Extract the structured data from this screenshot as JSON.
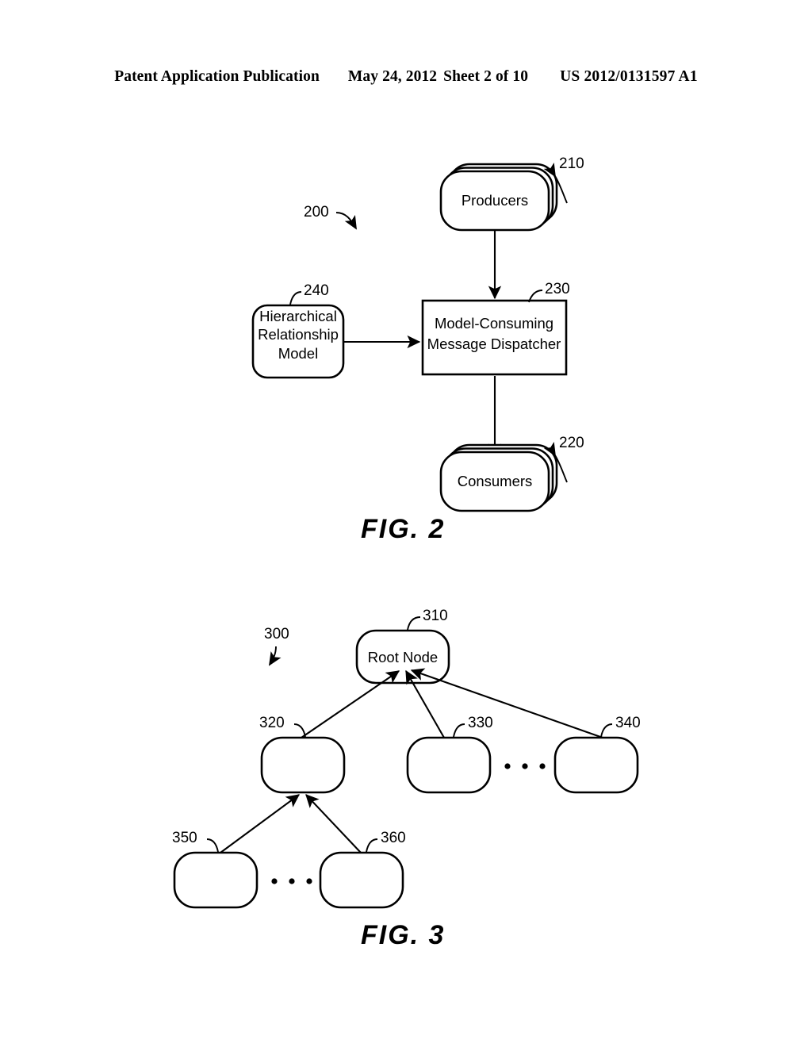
{
  "header": {
    "publication": "Patent Application Publication",
    "date": "May 24, 2012",
    "sheet": "Sheet 2 of 10",
    "document_number": "US 2012/0131597 A1"
  },
  "figures": [
    {
      "id": "fig2",
      "caption": "FIG.  2",
      "system_ref": "200",
      "nodes": [
        {
          "ref": "210",
          "label": "Producers",
          "shape": "stacked-rounded-rect"
        },
        {
          "ref": "230",
          "label_line1": "Model-Consuming",
          "label_line2": "Message Dispatcher",
          "shape": "rect"
        },
        {
          "ref": "240",
          "label_line1": "Hierarchical",
          "label_line2": "Relationship",
          "label_line3": "Model",
          "shape": "rounded-rect"
        },
        {
          "ref": "220",
          "label": "Consumers",
          "shape": "stacked-rounded-rect"
        }
      ],
      "connections": [
        {
          "from": "210",
          "to": "230",
          "style": "arrow"
        },
        {
          "from": "240",
          "to": "230",
          "style": "arrow"
        },
        {
          "from": "230",
          "to": "220",
          "style": "arrow"
        }
      ]
    },
    {
      "id": "fig3",
      "caption": "FIG.  3",
      "system_ref": "300",
      "nodes": [
        {
          "ref": "310",
          "label": "Root Node",
          "shape": "rounded-rect"
        },
        {
          "ref": "320",
          "label": "",
          "shape": "rounded-rect"
        },
        {
          "ref": "330",
          "label": "",
          "shape": "rounded-rect"
        },
        {
          "ref": "340",
          "label": "",
          "shape": "rounded-rect"
        },
        {
          "ref": "350",
          "label": "",
          "shape": "rounded-rect"
        },
        {
          "ref": "360",
          "label": "",
          "shape": "rounded-rect"
        }
      ],
      "ellipses": [
        {
          "between": [
            "330",
            "340"
          ],
          "dots": 3
        },
        {
          "between": [
            "350",
            "360"
          ],
          "dots": 3
        }
      ],
      "connections": [
        {
          "from": "320",
          "to": "310",
          "style": "arrow"
        },
        {
          "from": "330",
          "to": "310",
          "style": "arrow"
        },
        {
          "from": "340",
          "to": "310",
          "style": "arrow"
        },
        {
          "from": "350",
          "to": "320",
          "style": "arrow"
        },
        {
          "from": "360",
          "to": "320",
          "style": "arrow"
        }
      ]
    }
  ]
}
